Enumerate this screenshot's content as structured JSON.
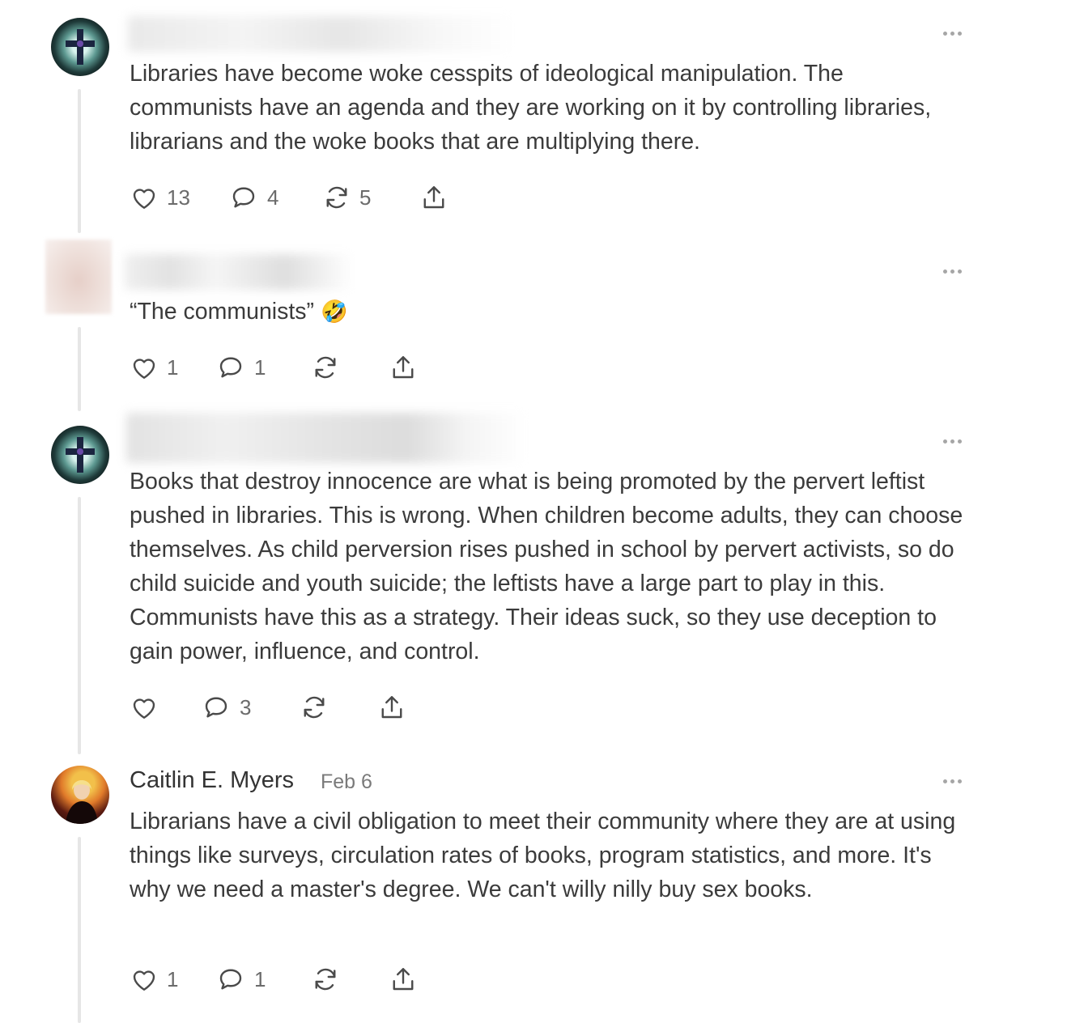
{
  "comments": [
    {
      "text": "Libraries have become woke cesspits of ideological manipulation. The communists have an agenda and they are working on it by controlling libraries, librarians and the woke books that are multiplying there.",
      "likes": "13",
      "replies": "4",
      "restacks": "5"
    },
    {
      "text": "“The communists” ",
      "emoji": "🤣",
      "likes": "1",
      "replies": "1",
      "restacks": ""
    },
    {
      "text": "Books that destroy innocence are what is being promoted by the pervert leftist pushed in libraries. This is wrong. When children become adults, they can choose themselves. As child perversion rises pushed in school by pervert activists, so do child suicide and youth suicide; the leftists have a large part to play in this. Communists have this as a strategy. Their ideas suck, so they use deception to gain power, influence, and control.",
      "likes": "",
      "replies": "3",
      "restacks": ""
    },
    {
      "author": "Caitlin E. Myers",
      "date": "Feb 6",
      "text": "Librarians have a civil obligation to meet their community where they are at using things like surveys, circulation rates of books, program statistics, and more. It's why we need a master's degree. We can't willy nilly buy sex books.",
      "likes": "1",
      "replies": "1",
      "restacks": ""
    }
  ],
  "icons": {
    "like": "heart-icon",
    "reply": "comment-bubble-icon",
    "restack": "restack-icon",
    "share": "share-icon",
    "more": "more-options-icon"
  }
}
